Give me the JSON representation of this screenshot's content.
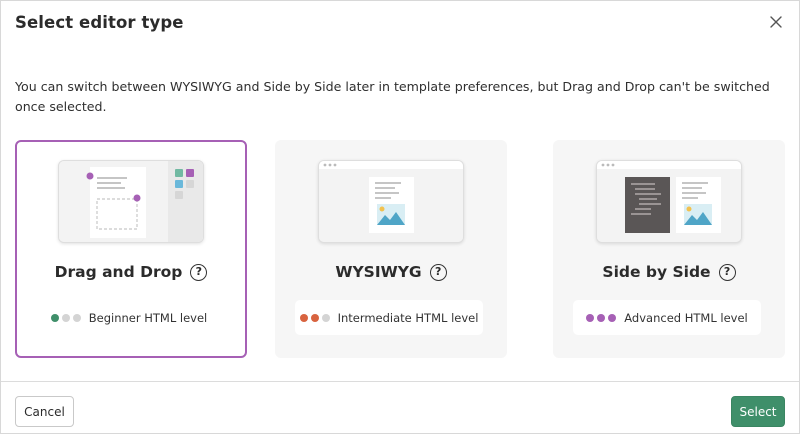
{
  "dialog": {
    "title": "Select editor type",
    "close_icon": "close-icon",
    "description": "You can switch between WYSIWYG and Side by Side later in template preferences, but Drag and Drop can't be switched once selected."
  },
  "cards": [
    {
      "name": "Drag and Drop",
      "help_icon": "?",
      "level": "Beginner HTML level",
      "selected": true,
      "dots": [
        "#3f8f6a",
        "#d4d4d4",
        "#d4d4d4"
      ]
    },
    {
      "name": "WYSIWYG",
      "help_icon": "?",
      "level": "Intermediate HTML level",
      "selected": false,
      "dots": [
        "#d8633f",
        "#d8633f",
        "#d4d4d4"
      ]
    },
    {
      "name": "Side by Side",
      "help_icon": "?",
      "level": "Advanced HTML level",
      "selected": false,
      "dots": [
        "#a660b5",
        "#a660b5",
        "#a660b5"
      ]
    }
  ],
  "footer": {
    "cancel_label": "Cancel",
    "select_label": "Select"
  },
  "colors": {
    "selected_border": "#a660b5",
    "primary_button": "#3f8f6a",
    "card_bg": "#f6f6f6"
  }
}
